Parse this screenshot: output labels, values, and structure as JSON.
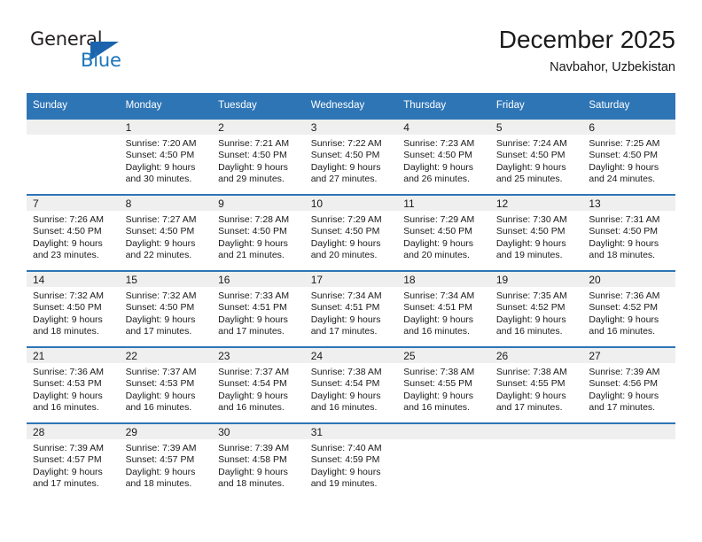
{
  "brand": {
    "name_top": "General",
    "name_bottom": "Blue",
    "color_dark": "#231f20",
    "color_blue": "#1b75bb"
  },
  "header": {
    "title": "December 2025",
    "subtitle": "Navbahor, Uzbekistan"
  },
  "theme": {
    "header_row_bg": "#2e75b6",
    "header_row_text": "#ffffff",
    "day_band_bg": "#efefef",
    "cell_border": "#2e75b6"
  },
  "weekdays": [
    "Sunday",
    "Monday",
    "Tuesday",
    "Wednesday",
    "Thursday",
    "Friday",
    "Saturday"
  ],
  "weeks": [
    [
      {
        "day": "",
        "sunrise": "",
        "sunset": "",
        "daylight1": "",
        "daylight2": "",
        "empty": true
      },
      {
        "day": "1",
        "sunrise": "Sunrise: 7:20 AM",
        "sunset": "Sunset: 4:50 PM",
        "daylight1": "Daylight: 9 hours",
        "daylight2": "and 30 minutes."
      },
      {
        "day": "2",
        "sunrise": "Sunrise: 7:21 AM",
        "sunset": "Sunset: 4:50 PM",
        "daylight1": "Daylight: 9 hours",
        "daylight2": "and 29 minutes."
      },
      {
        "day": "3",
        "sunrise": "Sunrise: 7:22 AM",
        "sunset": "Sunset: 4:50 PM",
        "daylight1": "Daylight: 9 hours",
        "daylight2": "and 27 minutes."
      },
      {
        "day": "4",
        "sunrise": "Sunrise: 7:23 AM",
        "sunset": "Sunset: 4:50 PM",
        "daylight1": "Daylight: 9 hours",
        "daylight2": "and 26 minutes."
      },
      {
        "day": "5",
        "sunrise": "Sunrise: 7:24 AM",
        "sunset": "Sunset: 4:50 PM",
        "daylight1": "Daylight: 9 hours",
        "daylight2": "and 25 minutes."
      },
      {
        "day": "6",
        "sunrise": "Sunrise: 7:25 AM",
        "sunset": "Sunset: 4:50 PM",
        "daylight1": "Daylight: 9 hours",
        "daylight2": "and 24 minutes."
      }
    ],
    [
      {
        "day": "7",
        "sunrise": "Sunrise: 7:26 AM",
        "sunset": "Sunset: 4:50 PM",
        "daylight1": "Daylight: 9 hours",
        "daylight2": "and 23 minutes."
      },
      {
        "day": "8",
        "sunrise": "Sunrise: 7:27 AM",
        "sunset": "Sunset: 4:50 PM",
        "daylight1": "Daylight: 9 hours",
        "daylight2": "and 22 minutes."
      },
      {
        "day": "9",
        "sunrise": "Sunrise: 7:28 AM",
        "sunset": "Sunset: 4:50 PM",
        "daylight1": "Daylight: 9 hours",
        "daylight2": "and 21 minutes."
      },
      {
        "day": "10",
        "sunrise": "Sunrise: 7:29 AM",
        "sunset": "Sunset: 4:50 PM",
        "daylight1": "Daylight: 9 hours",
        "daylight2": "and 20 minutes."
      },
      {
        "day": "11",
        "sunrise": "Sunrise: 7:29 AM",
        "sunset": "Sunset: 4:50 PM",
        "daylight1": "Daylight: 9 hours",
        "daylight2": "and 20 minutes."
      },
      {
        "day": "12",
        "sunrise": "Sunrise: 7:30 AM",
        "sunset": "Sunset: 4:50 PM",
        "daylight1": "Daylight: 9 hours",
        "daylight2": "and 19 minutes."
      },
      {
        "day": "13",
        "sunrise": "Sunrise: 7:31 AM",
        "sunset": "Sunset: 4:50 PM",
        "daylight1": "Daylight: 9 hours",
        "daylight2": "and 18 minutes."
      }
    ],
    [
      {
        "day": "14",
        "sunrise": "Sunrise: 7:32 AM",
        "sunset": "Sunset: 4:50 PM",
        "daylight1": "Daylight: 9 hours",
        "daylight2": "and 18 minutes."
      },
      {
        "day": "15",
        "sunrise": "Sunrise: 7:32 AM",
        "sunset": "Sunset: 4:50 PM",
        "daylight1": "Daylight: 9 hours",
        "daylight2": "and 17 minutes."
      },
      {
        "day": "16",
        "sunrise": "Sunrise: 7:33 AM",
        "sunset": "Sunset: 4:51 PM",
        "daylight1": "Daylight: 9 hours",
        "daylight2": "and 17 minutes."
      },
      {
        "day": "17",
        "sunrise": "Sunrise: 7:34 AM",
        "sunset": "Sunset: 4:51 PM",
        "daylight1": "Daylight: 9 hours",
        "daylight2": "and 17 minutes."
      },
      {
        "day": "18",
        "sunrise": "Sunrise: 7:34 AM",
        "sunset": "Sunset: 4:51 PM",
        "daylight1": "Daylight: 9 hours",
        "daylight2": "and 16 minutes."
      },
      {
        "day": "19",
        "sunrise": "Sunrise: 7:35 AM",
        "sunset": "Sunset: 4:52 PM",
        "daylight1": "Daylight: 9 hours",
        "daylight2": "and 16 minutes."
      },
      {
        "day": "20",
        "sunrise": "Sunrise: 7:36 AM",
        "sunset": "Sunset: 4:52 PM",
        "daylight1": "Daylight: 9 hours",
        "daylight2": "and 16 minutes."
      }
    ],
    [
      {
        "day": "21",
        "sunrise": "Sunrise: 7:36 AM",
        "sunset": "Sunset: 4:53 PM",
        "daylight1": "Daylight: 9 hours",
        "daylight2": "and 16 minutes."
      },
      {
        "day": "22",
        "sunrise": "Sunrise: 7:37 AM",
        "sunset": "Sunset: 4:53 PM",
        "daylight1": "Daylight: 9 hours",
        "daylight2": "and 16 minutes."
      },
      {
        "day": "23",
        "sunrise": "Sunrise: 7:37 AM",
        "sunset": "Sunset: 4:54 PM",
        "daylight1": "Daylight: 9 hours",
        "daylight2": "and 16 minutes."
      },
      {
        "day": "24",
        "sunrise": "Sunrise: 7:38 AM",
        "sunset": "Sunset: 4:54 PM",
        "daylight1": "Daylight: 9 hours",
        "daylight2": "and 16 minutes."
      },
      {
        "day": "25",
        "sunrise": "Sunrise: 7:38 AM",
        "sunset": "Sunset: 4:55 PM",
        "daylight1": "Daylight: 9 hours",
        "daylight2": "and 16 minutes."
      },
      {
        "day": "26",
        "sunrise": "Sunrise: 7:38 AM",
        "sunset": "Sunset: 4:55 PM",
        "daylight1": "Daylight: 9 hours",
        "daylight2": "and 17 minutes."
      },
      {
        "day": "27",
        "sunrise": "Sunrise: 7:39 AM",
        "sunset": "Sunset: 4:56 PM",
        "daylight1": "Daylight: 9 hours",
        "daylight2": "and 17 minutes."
      }
    ],
    [
      {
        "day": "28",
        "sunrise": "Sunrise: 7:39 AM",
        "sunset": "Sunset: 4:57 PM",
        "daylight1": "Daylight: 9 hours",
        "daylight2": "and 17 minutes."
      },
      {
        "day": "29",
        "sunrise": "Sunrise: 7:39 AM",
        "sunset": "Sunset: 4:57 PM",
        "daylight1": "Daylight: 9 hours",
        "daylight2": "and 18 minutes."
      },
      {
        "day": "30",
        "sunrise": "Sunrise: 7:39 AM",
        "sunset": "Sunset: 4:58 PM",
        "daylight1": "Daylight: 9 hours",
        "daylight2": "and 18 minutes."
      },
      {
        "day": "31",
        "sunrise": "Sunrise: 7:40 AM",
        "sunset": "Sunset: 4:59 PM",
        "daylight1": "Daylight: 9 hours",
        "daylight2": "and 19 minutes."
      },
      {
        "day": "",
        "sunrise": "",
        "sunset": "",
        "daylight1": "",
        "daylight2": "",
        "empty": true
      },
      {
        "day": "",
        "sunrise": "",
        "sunset": "",
        "daylight1": "",
        "daylight2": "",
        "empty": true
      },
      {
        "day": "",
        "sunrise": "",
        "sunset": "",
        "daylight1": "",
        "daylight2": "",
        "empty": true
      }
    ]
  ]
}
